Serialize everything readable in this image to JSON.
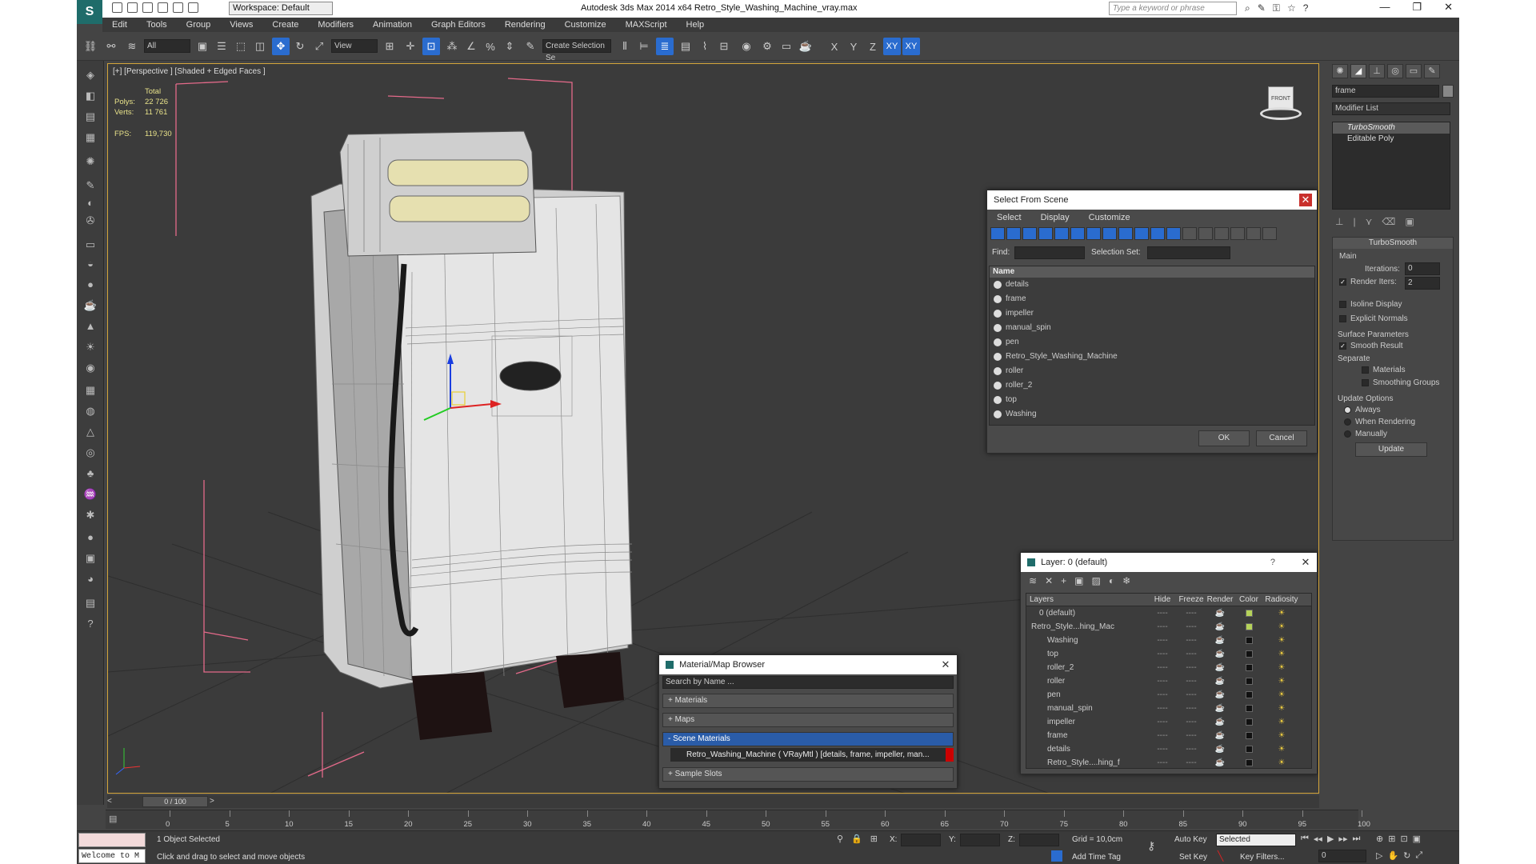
{
  "app": {
    "title": "Autodesk 3ds Max  2014 x64      Retro_Style_Washing_Machine_vray.max",
    "logo": "3ds-max-logo",
    "workspace": "Workspace: Default",
    "search_placeholder": "Type a keyword or phrase",
    "window_controls": [
      "—",
      "❐",
      "✕"
    ]
  },
  "menu": [
    "Edit",
    "Tools",
    "Group",
    "Views",
    "Create",
    "Modifiers",
    "Animation",
    "Graph Editors",
    "Rendering",
    "Customize",
    "MAXScript",
    "Help"
  ],
  "toolbar": {
    "selection_filter": "All",
    "ref_coord": "View",
    "selection_set": "Create Selection Se",
    "axis_x": "X",
    "axis_y": "Y",
    "axis_z": "Z",
    "axis_xy": "XY",
    "axis_xy2": "XY"
  },
  "viewport": {
    "label": "[+] [Perspective ] [Shaded + Edged Faces ]",
    "stats_total": "Total",
    "polys_label": "Polys:",
    "polys": "22 726",
    "verts_label": "Verts:",
    "verts": "11 761",
    "fps_label": "FPS:",
    "fps": "119,730",
    "viewcube": "FRONT"
  },
  "select_from_scene": {
    "title": "Select From Scene",
    "menu": [
      "Select",
      "Display",
      "Customize"
    ],
    "find_label": "Find:",
    "selection_set_label": "Selection Set:",
    "column_name": "Name",
    "items": [
      "details",
      "frame",
      "impeller",
      "manual_spin",
      "pen",
      "Retro_Style_Washing_Machine",
      "roller",
      "roller_2",
      "top",
      "Washing"
    ],
    "ok": "OK",
    "cancel": "Cancel"
  },
  "layer_dialog": {
    "title": "Layer: 0 (default)",
    "help": "?",
    "columns": [
      "Layers",
      "Hide",
      "Freeze",
      "Render",
      "Color",
      "Radiosity"
    ],
    "rows": [
      {
        "name": "0 (default)",
        "indent": 1,
        "color": "#b6d35a"
      },
      {
        "name": "Retro_Style...hing_Mac",
        "indent": 0,
        "color": "#b6d35a"
      },
      {
        "name": "Washing",
        "indent": 2,
        "color": "#111111"
      },
      {
        "name": "top",
        "indent": 2,
        "color": "#111111"
      },
      {
        "name": "roller_2",
        "indent": 2,
        "color": "#111111"
      },
      {
        "name": "roller",
        "indent": 2,
        "color": "#111111"
      },
      {
        "name": "pen",
        "indent": 2,
        "color": "#111111"
      },
      {
        "name": "manual_spin",
        "indent": 2,
        "color": "#111111"
      },
      {
        "name": "impeller",
        "indent": 2,
        "color": "#111111"
      },
      {
        "name": "frame",
        "indent": 2,
        "color": "#111111"
      },
      {
        "name": "details",
        "indent": 2,
        "color": "#111111"
      },
      {
        "name": "Retro_Style....hing_f",
        "indent": 2,
        "color": "#111111"
      }
    ],
    "dash": "----",
    "check": "✓"
  },
  "material_browser": {
    "title": "Material/Map Browser",
    "search": "Search by Name ...",
    "materials": "+ Materials",
    "maps": "+ Maps",
    "scene_materials": "- Scene Materials",
    "material_item": "Retro_Washing_Machine  ( VRayMtl )  [details, frame, impeller, man...",
    "sample_slots": "+ Sample Slots"
  },
  "command_panel": {
    "object_name": "frame",
    "modifier_list": "Modifier List",
    "stack": [
      "TurboSmooth",
      "Editable Poly"
    ],
    "turbosmooth": "TurboSmooth",
    "main": "Main",
    "iterations_label": "Iterations:",
    "iterations": "0",
    "render_iters_label": "Render Iters:",
    "render_iters": "2",
    "isoline": "Isoline Display",
    "explicit_normals": "Explicit Normals",
    "surface_params": "Surface Parameters",
    "smooth_result": "Smooth Result",
    "separate": "Separate",
    "materials": "Materials",
    "smoothing_groups": "Smoothing Groups",
    "update_options": "Update Options",
    "always": "Always",
    "when_rendering": "When Rendering",
    "manually": "Manually",
    "update": "Update"
  },
  "timeline": {
    "frame": "0 / 100",
    "ticks": [
      "0",
      "5",
      "10",
      "15",
      "20",
      "25",
      "30",
      "35",
      "40",
      "45",
      "50",
      "55",
      "60",
      "65",
      "70",
      "75",
      "80",
      "85",
      "90",
      "95",
      "100"
    ]
  },
  "status": {
    "maxscript_top": "",
    "maxscript_bottom": "Welcome to M",
    "selected": "1 Object Selected",
    "prompt": "Click and drag to select and move objects",
    "x_label": "X:",
    "y_label": "Y:",
    "z_label": "Z:",
    "grid": "Grid = 10,0cm",
    "add_time_tag": "Add Time Tag",
    "auto_key": "Auto Key",
    "set_key": "Set Key",
    "selected_dropdown": "Selected",
    "key_filters": "Key Filters...",
    "frame_field": "0"
  }
}
